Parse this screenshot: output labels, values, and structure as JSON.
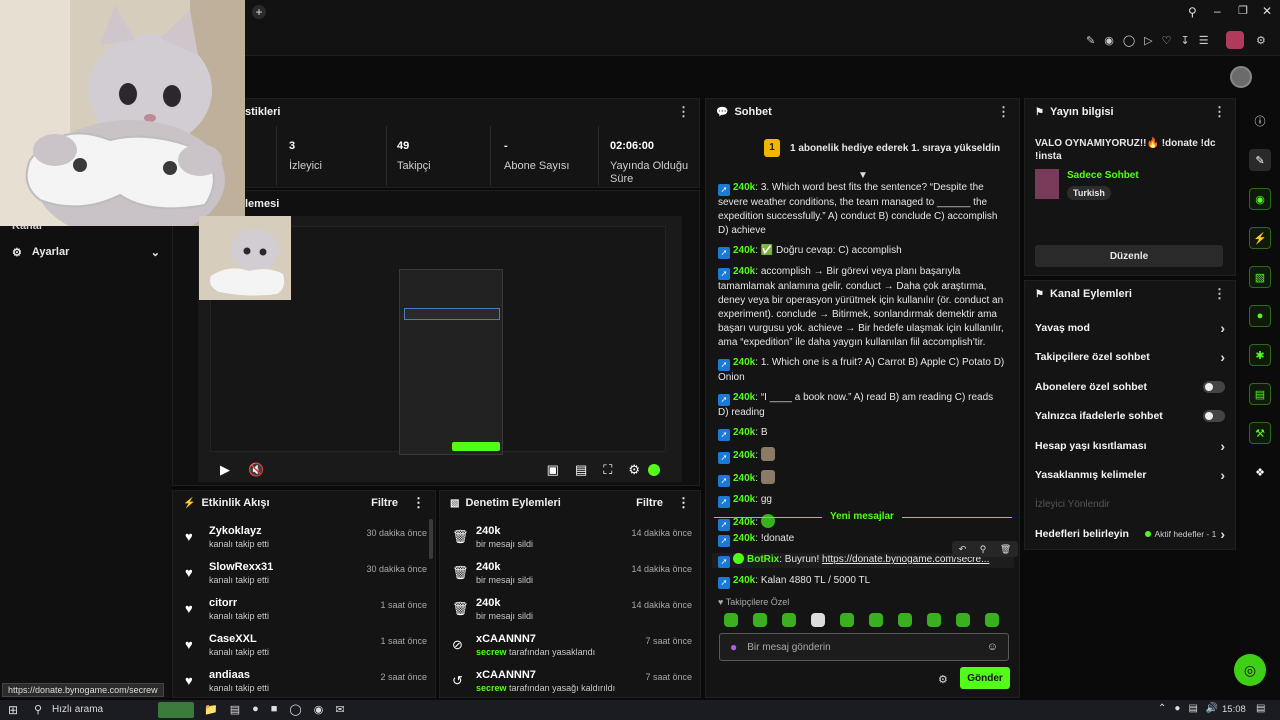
{
  "browser": {
    "status_url": "https://donate.bynogame.com/secrew",
    "new_tab_glyph": "+"
  },
  "stats_panel": {
    "title_fragment": "stikleri",
    "items": [
      {
        "value": "3",
        "label": "İzleyici"
      },
      {
        "value": "49",
        "label": "Takipçi"
      },
      {
        "value": "-",
        "label": "Abone Sayısı"
      },
      {
        "value": "02:06:00",
        "label": "Yayında Olduğu Süre"
      }
    ]
  },
  "left_sidebar": {
    "kanal_fragment": "Kanal",
    "settings_label": "Ayarlar"
  },
  "preview_panel": {
    "title_fragment": "lemesi"
  },
  "activity_feed": {
    "title": "Etkinlik Akışı",
    "filter": "Filtre",
    "rows": [
      {
        "name": "Zykoklayz",
        "sub": "kanalı takip etti",
        "time": "30 dakika önce"
      },
      {
        "name": "SlowRexx31",
        "sub": "kanalı takip etti",
        "time": "30 dakika önce"
      },
      {
        "name": "citorr",
        "sub": "kanalı takip etti",
        "time": "1 saat önce"
      },
      {
        "name": "CaseXXL",
        "sub": "kanalı takip etti",
        "time": "1 saat önce"
      },
      {
        "name": "andiaas",
        "sub": "kanalı takip etti",
        "time": "2 saat önce"
      }
    ]
  },
  "mod_actions": {
    "title": "Denetim Eylemleri",
    "filter": "Filtre",
    "rows": [
      {
        "name": "240k",
        "sub": "bir mesajı sildi",
        "time": "14 dakika önce",
        "icon": "trash-icon"
      },
      {
        "name": "240k",
        "sub": "bir mesajı sildi",
        "time": "14 dakika önce",
        "icon": "trash-icon"
      },
      {
        "name": "240k",
        "sub": "bir mesajı sildi",
        "time": "14 dakika önce",
        "icon": "trash-icon"
      },
      {
        "name": "xCAANNN7",
        "sub_user": "secrew",
        "sub": "tarafından yasaklandı",
        "time": "7 saat önce",
        "icon": "ban-icon"
      },
      {
        "name": "xCAANNN7",
        "sub_user": "secrew",
        "sub": "tarafından yasağı kaldırıldı",
        "time": "7 saat önce",
        "icon": "undo-icon"
      }
    ]
  },
  "chat": {
    "title": "Sohbet",
    "leader_rank": "1",
    "leader_text": "1 abonelik hediye ederek 1. sıraya yükseldin",
    "messages": [
      {
        "user": "240k",
        "text": "3. Which word best fits the sentence? “Despite the severe weather conditions, the team managed to ______ the expedition successfully.” A) conduct B) conclude C) accomplish D) achieve"
      },
      {
        "user": "240k",
        "text": "✅ Doğru cevap: C) accomplish"
      },
      {
        "user": "240k",
        "text": "accomplish → Bir görevi veya planı başarıyla tamamlamak anlamına gelir. conduct → Daha çok araştırma, deney veya bir operasyon yürütmek için kullanılır (ör. conduct an experiment). conclude → Bitirmek, sonlandırmak demektir ama başarı vurgusu yok. achieve → Bir hedefe ulaşmak için kullanılır, ama “expedition” ile daha yaygın kullanılan fiil accomplish’tir."
      },
      {
        "user": "240k",
        "text": "1. Which one is a fruit? A) Carrot B) Apple C) Potato D) Onion"
      },
      {
        "user": "240k",
        "text": "“I ____ a book now.” A) read B) am reading C) reads D) reading"
      },
      {
        "user": "240k",
        "text": "B"
      },
      {
        "user": "240k",
        "text": ""
      },
      {
        "user": "240k",
        "text": ""
      },
      {
        "user": "240k",
        "text": "gg"
      },
      {
        "user": "240k",
        "text": ""
      }
    ],
    "new_messages_label": "Yeni mesajlar",
    "new_messages": [
      {
        "user": "240k",
        "text": "!donate"
      },
      {
        "user": "BotRix",
        "text": "Buyrun! ",
        "link": "https://donate.bynogame.com/secre..."
      },
      {
        "user": "240k",
        "text": "Kalan 4880 TL / 5000 TL"
      }
    ],
    "emote_section": "Takipçilere Özel",
    "input_placeholder": "Bir mesaj gönderin",
    "send_label": "Gönder"
  },
  "stream_info": {
    "title": "Yayın bilgisi",
    "stream_title": "VALO OYNAMIYORUZ!!🔥 !donate !dc !insta",
    "category": "Sadece Sohbet",
    "language": "Turkish",
    "edit_label": "Düzenle"
  },
  "channel_actions": {
    "title": "Kanal Eylemleri",
    "rows": [
      {
        "label": "Yavaş mod",
        "control": "chevron"
      },
      {
        "label": "Takipçilere özel sohbet",
        "control": "chevron"
      },
      {
        "label": "Abonelere özel sohbet",
        "control": "toggle"
      },
      {
        "label": "Yalnızca ifadelerle sohbet",
        "control": "toggle"
      },
      {
        "label": "Hesap yaşı kısıtlaması",
        "control": "chevron"
      },
      {
        "label": "Yasaklanmış kelimeler",
        "control": "chevron"
      }
    ],
    "viewer_redirect": "İzleyici Yönlendir",
    "goals_label": "Hedefleri belirleyin",
    "goals_status": "Aktif hedefler - 1"
  },
  "taskbar": {
    "search_placeholder": "Hızlı arama",
    "clock": "15:08"
  },
  "colors": {
    "accent": "#53fc18",
    "panel": "#141414",
    "background": "#0a0a0a"
  }
}
